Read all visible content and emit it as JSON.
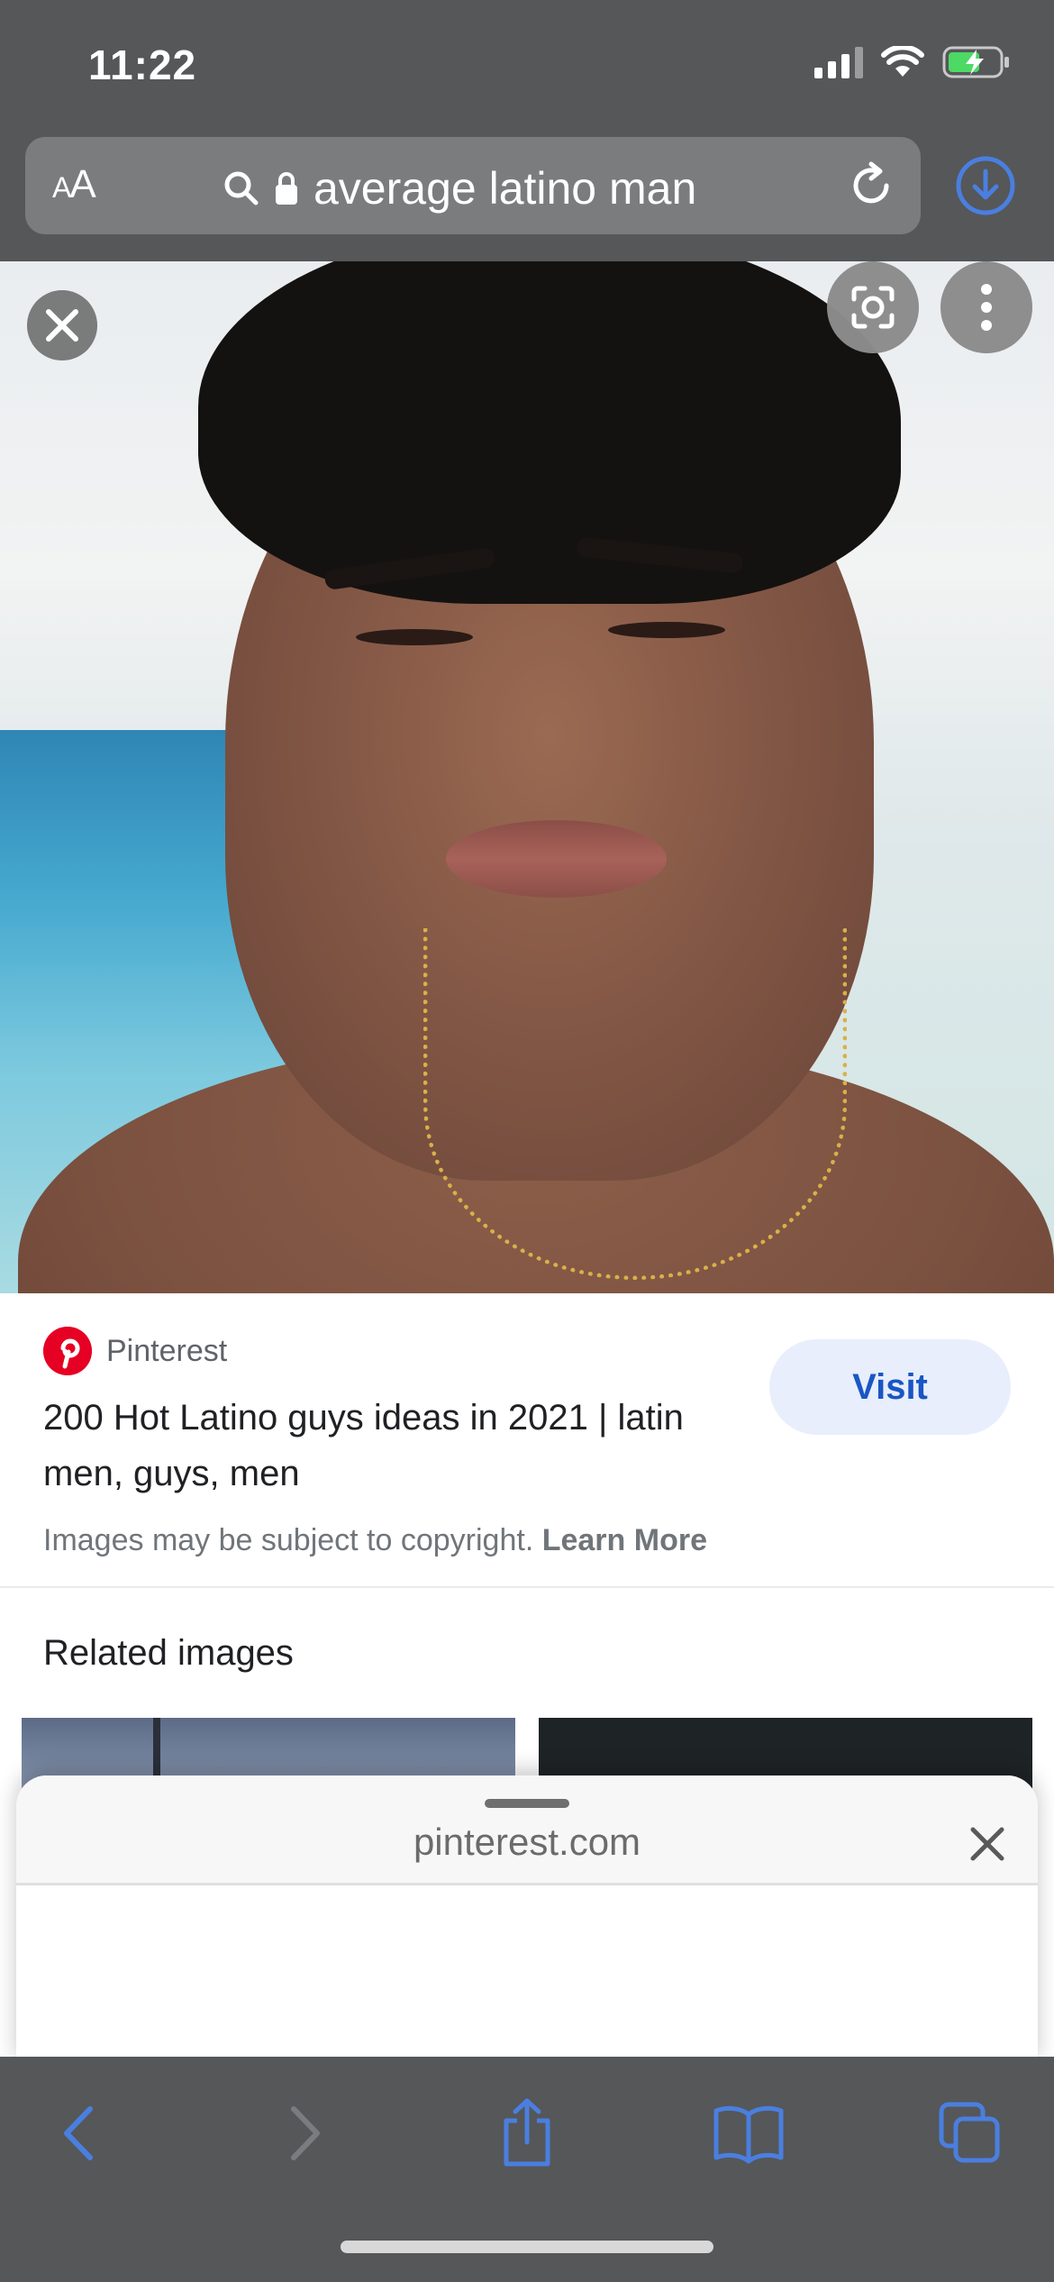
{
  "status_bar": {
    "time": "11:22"
  },
  "browser": {
    "text_size_label_small": "A",
    "text_size_label_large": "A",
    "url_text": "average latino man",
    "accent_color": "#4a7fe0"
  },
  "result": {
    "source_name": "Pinterest",
    "title": "200 Hot Latino guys ideas in 2021 | latin men, guys, men",
    "visit_label": "Visit",
    "copyright_text": "Images may be subject to copyright.",
    "learn_more_label": "Learn More",
    "related_heading": "Related images"
  },
  "sheet": {
    "domain": "pinterest.com"
  },
  "toolbar": {
    "items": [
      "back-icon",
      "forward-icon",
      "share-icon",
      "bookmarks-icon",
      "tabs-icon"
    ]
  }
}
